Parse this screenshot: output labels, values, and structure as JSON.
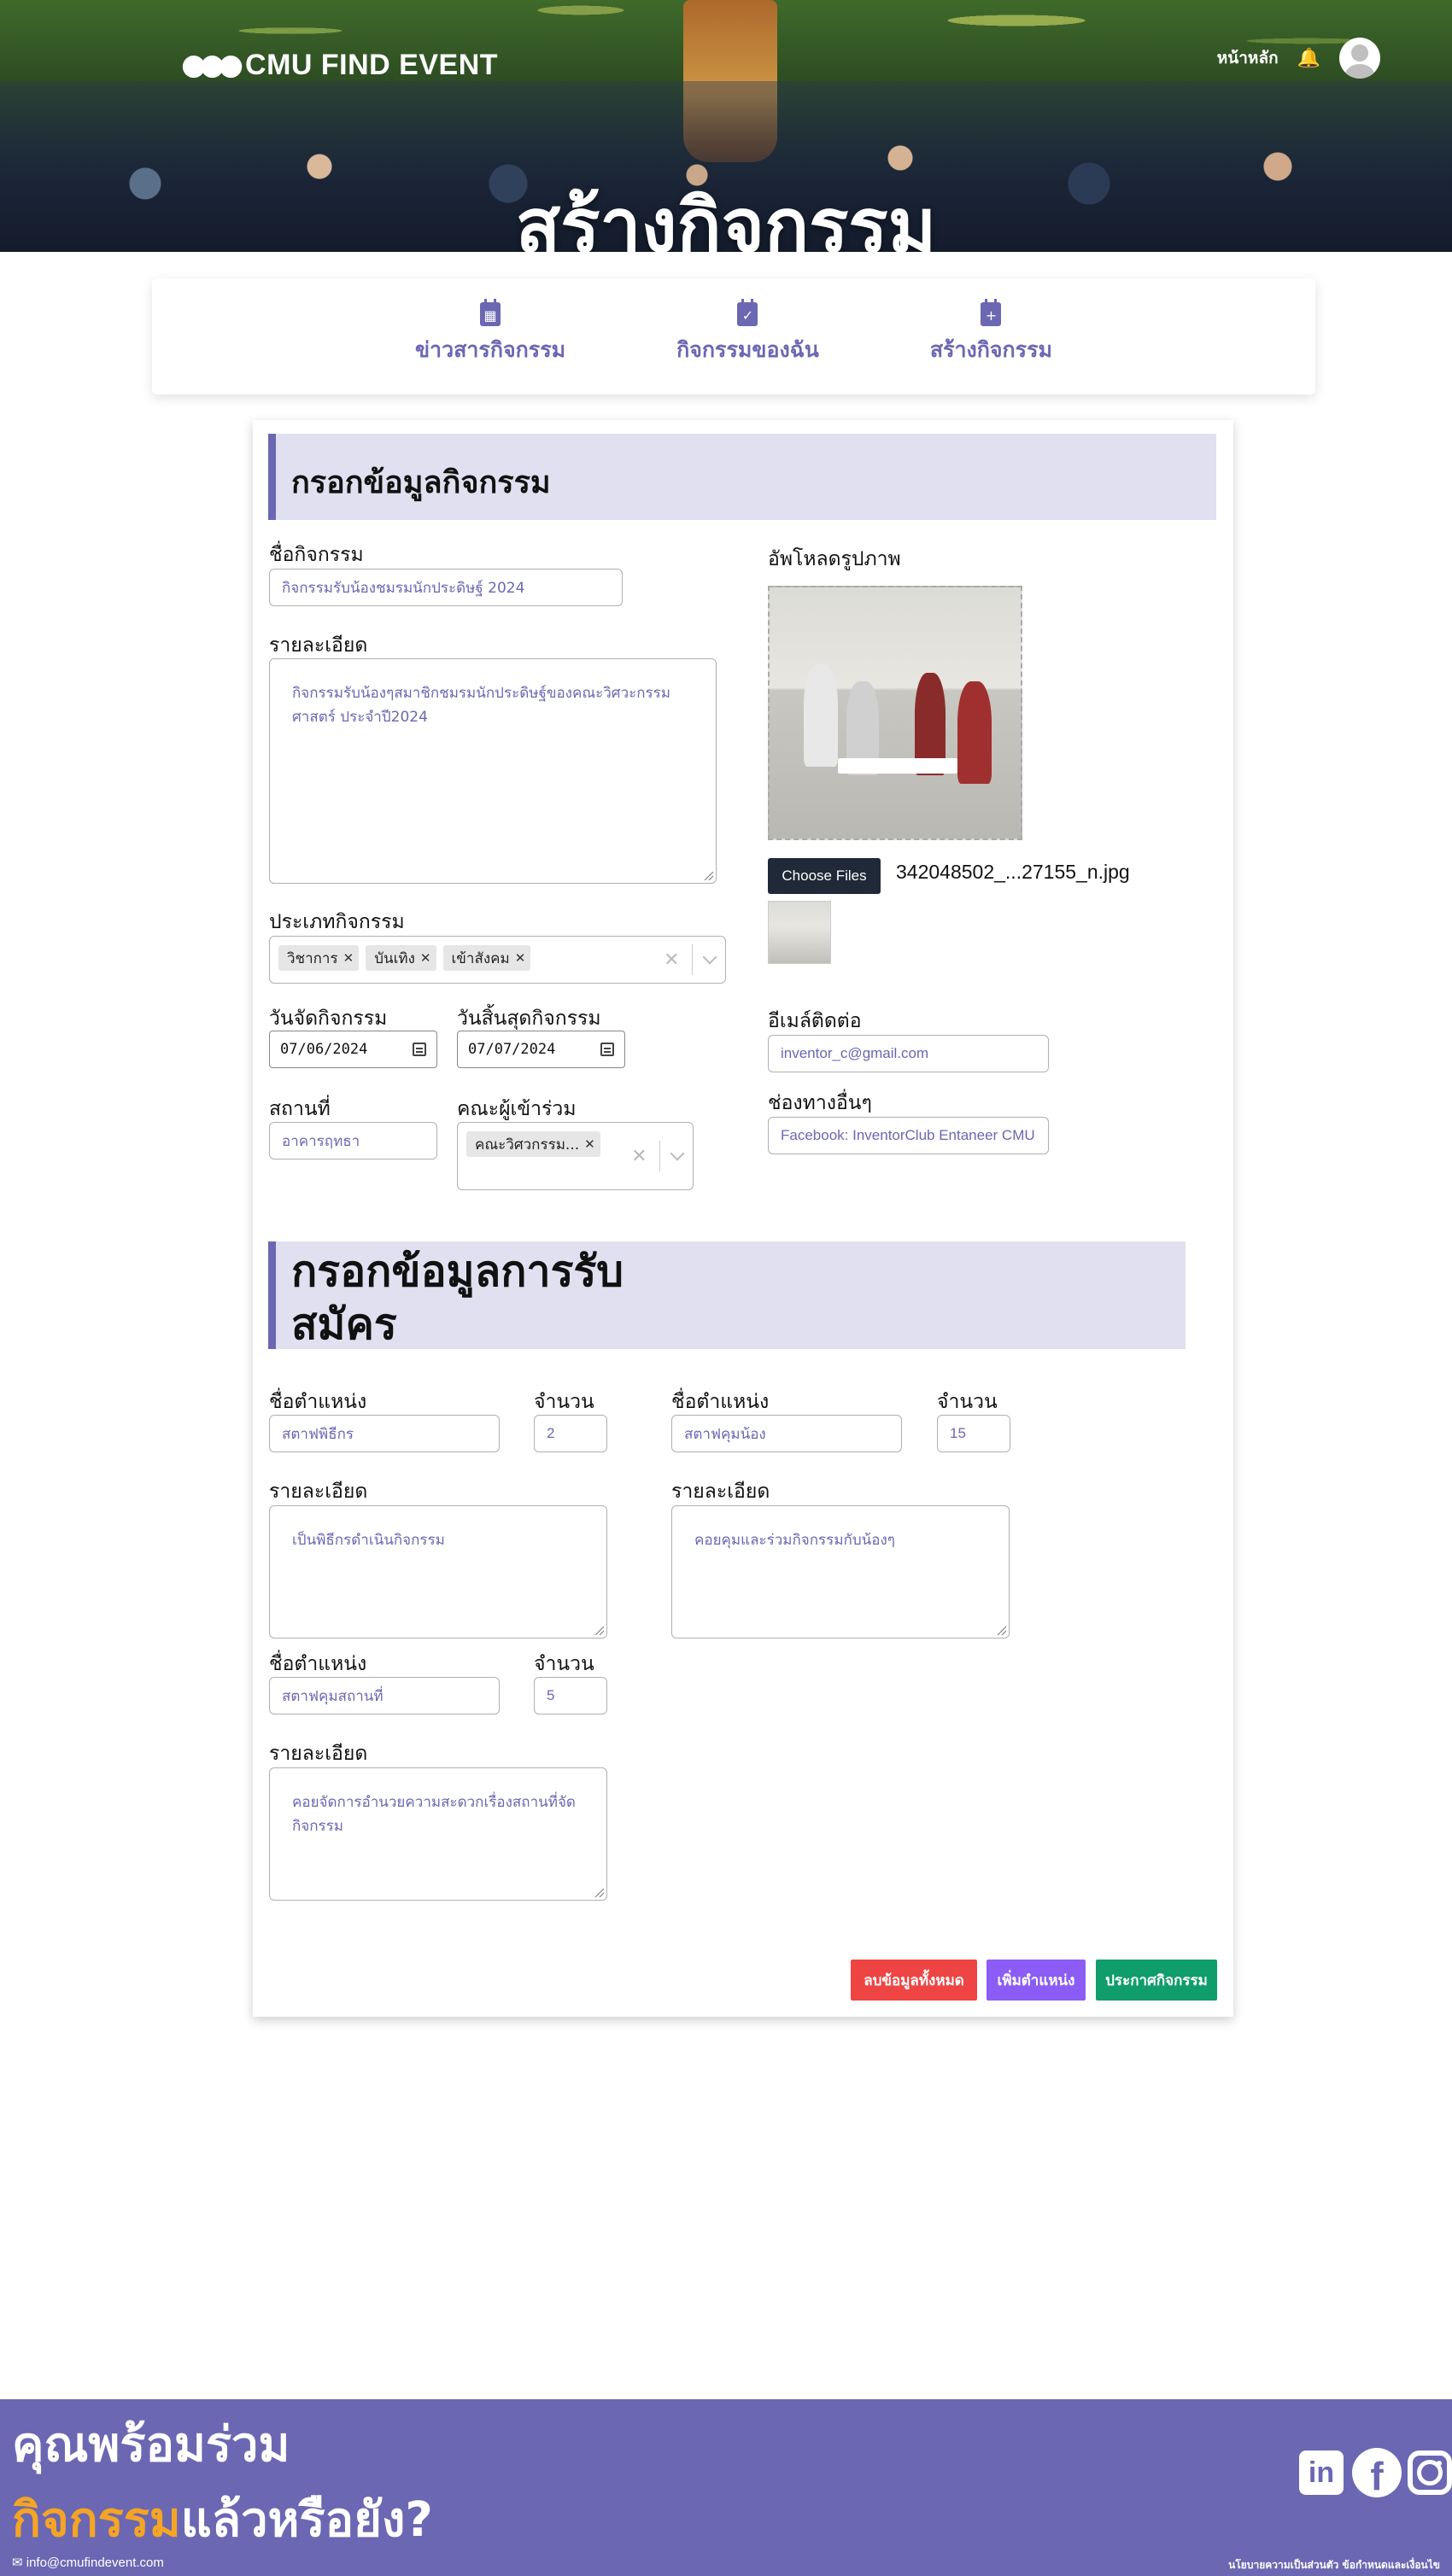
{
  "brand": {
    "name": "CMU FIND EVENT"
  },
  "topnav": {
    "home": "หน้าหลัก"
  },
  "hero": {
    "title": "สร้างกิจกรรม"
  },
  "tabs": [
    {
      "label": "ข่าวสารกิจกรรม",
      "icon": "calendar-icon"
    },
    {
      "label": "กิจกรรมของฉัน",
      "icon": "calendar-check-icon"
    },
    {
      "label": "สร้างกิจกรรม",
      "icon": "calendar-plus-icon"
    }
  ],
  "event_section": {
    "title": "กรอกข้อมูลกิจกรรม",
    "name_label": "ชื่อกิจกรรม",
    "name_value": "กิจกรรมรับน้องชมรมนักประดิษฐ์ 2024",
    "detail_label": "รายละเอียด",
    "detail_value": "กิจกรรมรับน้องๆสมาชิกชมรมนักประดิษฐ์ของคณะวิศวะกรรมศาสตร์ ประจำปี2024",
    "type_label": "ประเภทกิจกรรม",
    "types": [
      "วิชาการ",
      "บันเทิง",
      "เข้าสังคม"
    ],
    "start_label": "วันจัดกิจกรรม",
    "start_value": "07/06/2024",
    "end_label": "วันสิ้นสุดกิจกรรม",
    "end_value": "07/07/2024",
    "place_label": "สถานที่",
    "place_value": "อาคารฤทธา",
    "faculty_label": "คณะผู้เข้าร่วม",
    "faculties": [
      "คณะวิศวกรรม..."
    ],
    "upload_label": "อัพโหลดรูปภาพ",
    "choose_files": "Choose Files",
    "file_name": "342048502_...27155_n.jpg",
    "email_label": "อีเมล์ติดต่อ",
    "email_value": "inventor_c@gmail.com",
    "other_label": "ช่องทางอื่นๆ",
    "other_value": "Facebook: InventorClub Entaneer CMU"
  },
  "apply_section": {
    "title_line1": "กรอกข้อมูลการรับ",
    "title_line2": "สมัคร",
    "position_label": "ชื่อตำแหน่ง",
    "count_label": "จำนวน",
    "detail_label": "รายละเอียด",
    "positions": [
      {
        "name": "สตาฟพิธีกร",
        "count": "2",
        "detail": "เป็นพิธีกรดำเนินกิจกรรม"
      },
      {
        "name": "สตาฟคุมน้อง",
        "count": "15",
        "detail": "คอยคุมและร่วมกิจกรรมกับน้องๆ"
      },
      {
        "name": "สตาฟคุมสถานที่",
        "count": "5",
        "detail": "คอยจัดการอำนวยความสะดวกเรื่องสถานที่จัดกิจกรรม"
      }
    ]
  },
  "buttons": {
    "clear": "ลบข้อมูลทั้งหมด",
    "add_position": "เพิ่มตำแหน่ง",
    "publish": "ประกาศกิจกรรม"
  },
  "colors": {
    "primary": "#6b67b3",
    "danger": "#ef4444",
    "add": "#8b5cf6",
    "success": "#0f9d6b",
    "accent": "#f5a524"
  },
  "footer": {
    "line1": "คุณพร้อมร่วม",
    "line2_highlight": "กิจกรรม",
    "line2_rest": "แล้วหรือยัง?",
    "email": "info@cmufindevent.com",
    "links": "นโยบายความเป็นส่วนตัว  ข้อกำหนดและเงื่อนไข"
  }
}
